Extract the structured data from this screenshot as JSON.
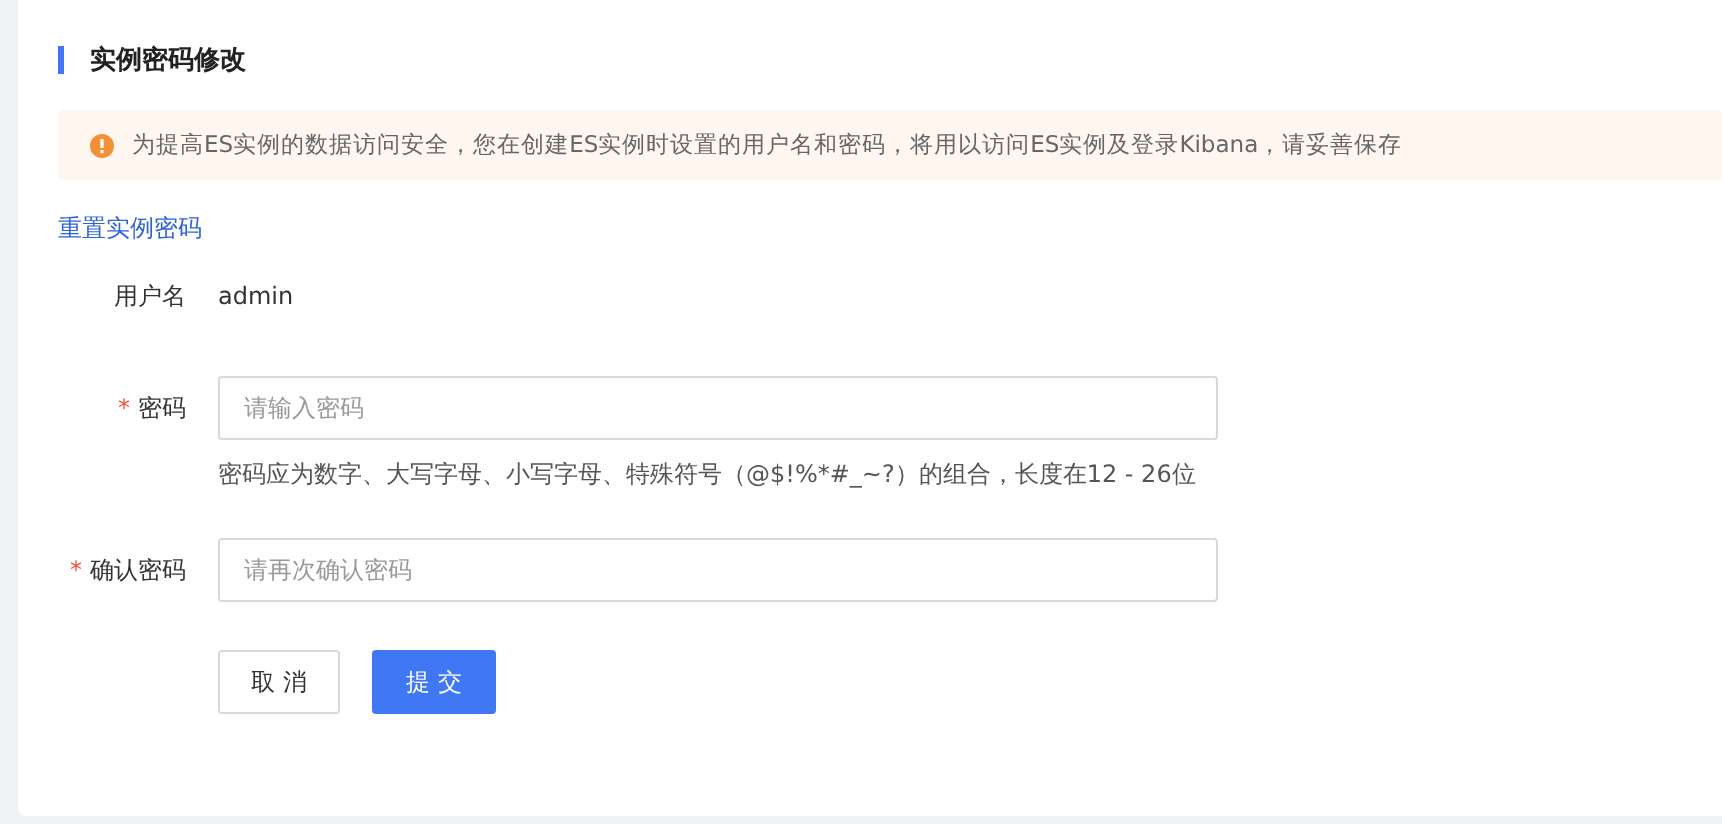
{
  "section": {
    "title": "实例密码修改"
  },
  "alert": {
    "kind": "warning",
    "message": "为提高ES实例的数据访问安全，您在创建ES实例时设置的用户名和密码，将用以访问ES实例及登录Kibana，请妥善保存"
  },
  "reset_link": "重置实例密码",
  "form": [
    {
      "kind": "text",
      "label": "用户名",
      "value": "admin"
    },
    {
      "kind": "input",
      "label": "密码",
      "required_mark": "*",
      "placeholder": "请输入密码",
      "hint": "密码应为数字、大写字母、小写字母、特殊符号（@$!%*#_~?）的组合，长度在12 - 26位"
    },
    {
      "kind": "input",
      "label": "确认密码",
      "required_mark": "*",
      "placeholder": "请再次确认密码"
    }
  ],
  "buttons": [
    {
      "label": "取 消",
      "kind": "default"
    },
    {
      "label": "提 交",
      "kind": "primary"
    }
  ]
}
